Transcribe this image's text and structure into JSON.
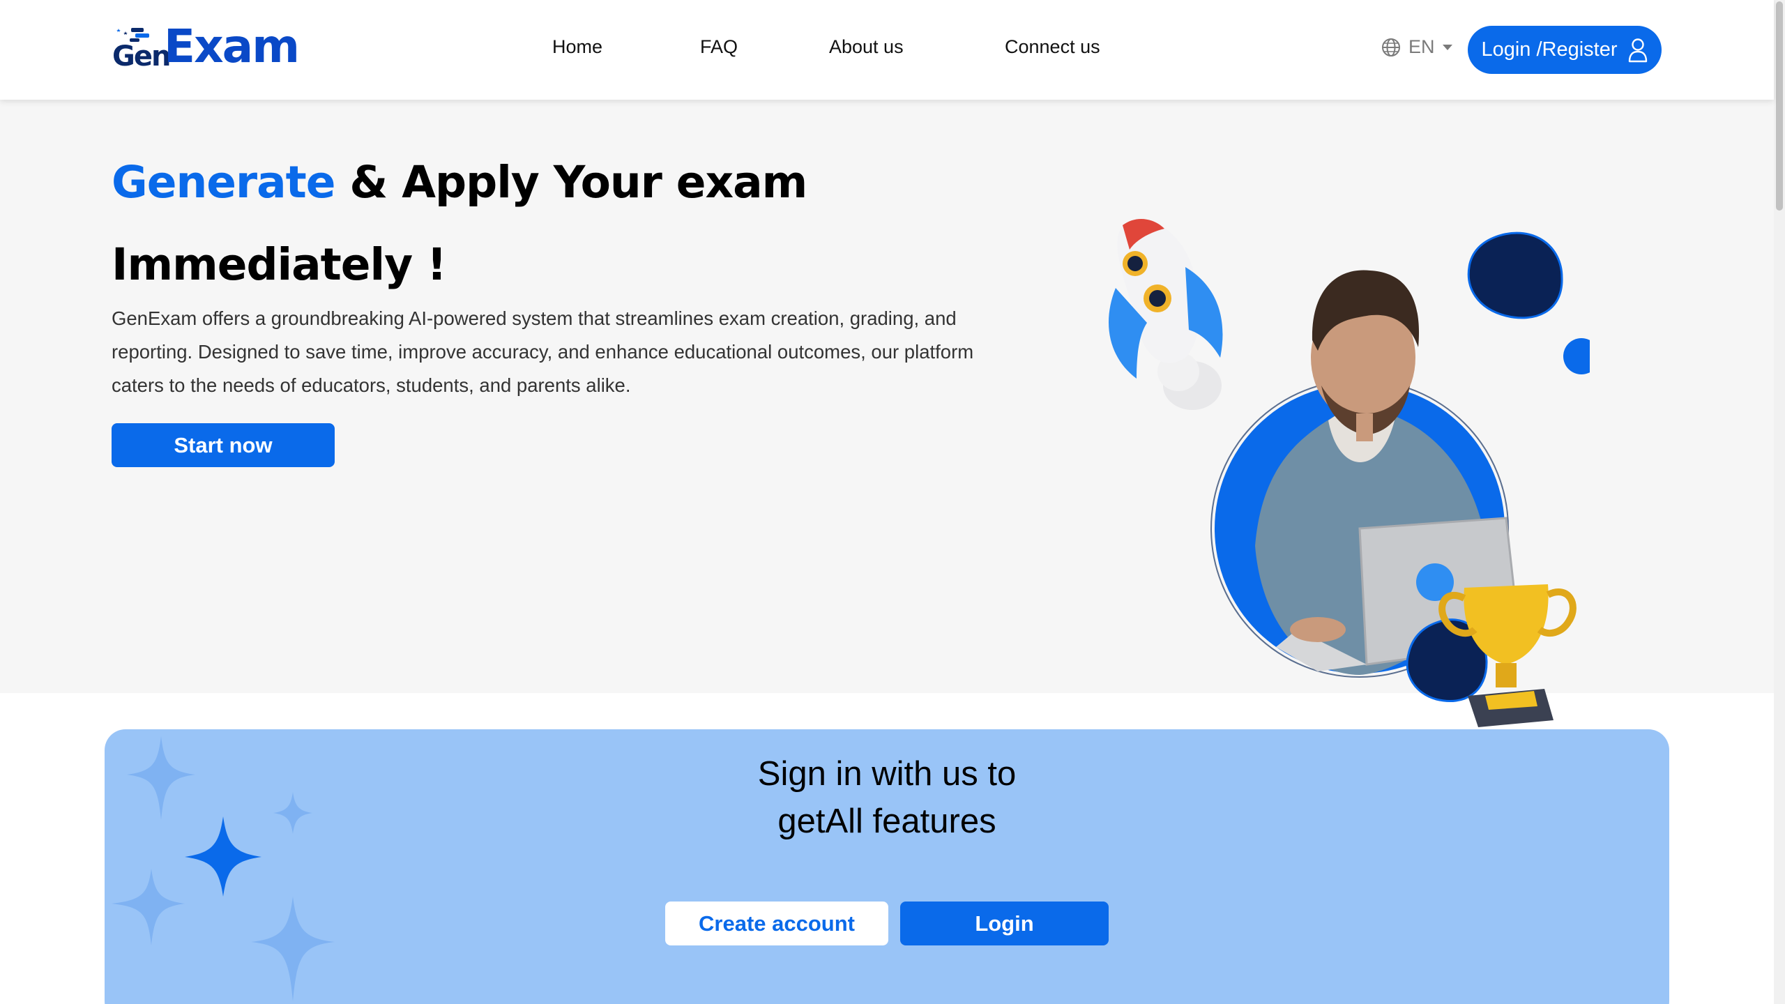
{
  "header": {
    "logo": {
      "gen": "Gen",
      "exam": "Exam"
    },
    "nav": [
      "Home",
      "FAQ",
      "About us",
      "Connect us"
    ],
    "language": {
      "label": "EN"
    },
    "login_register": "Login /Register"
  },
  "hero": {
    "title_accent": "Generate",
    "title_rest": " & Apply Your exam",
    "title_line2": "Immediately !",
    "description": "GenExam offers a groundbreaking AI-powered system that streamlines exam creation, grading, and reporting. Designed to save time, improve accuracy, and enhance educational outcomes, our platform caters to the needs of educators, students, and parents alike.",
    "start_button": "Start now"
  },
  "banner": {
    "title_line1": "Sign in with us to",
    "title_line2": "getAll features",
    "create_account": "Create account",
    "login": "Login"
  },
  "colors": {
    "primary": "#0a6aea",
    "dark_navy": "#0b2a6b",
    "banner_bg": "#99c4f7",
    "hero_bg": "#f6f6f6"
  },
  "icons": [
    "globe-icon",
    "caret-down-icon",
    "user-icon",
    "rocket-icon",
    "trophy-icon",
    "sparkle-icon"
  ]
}
